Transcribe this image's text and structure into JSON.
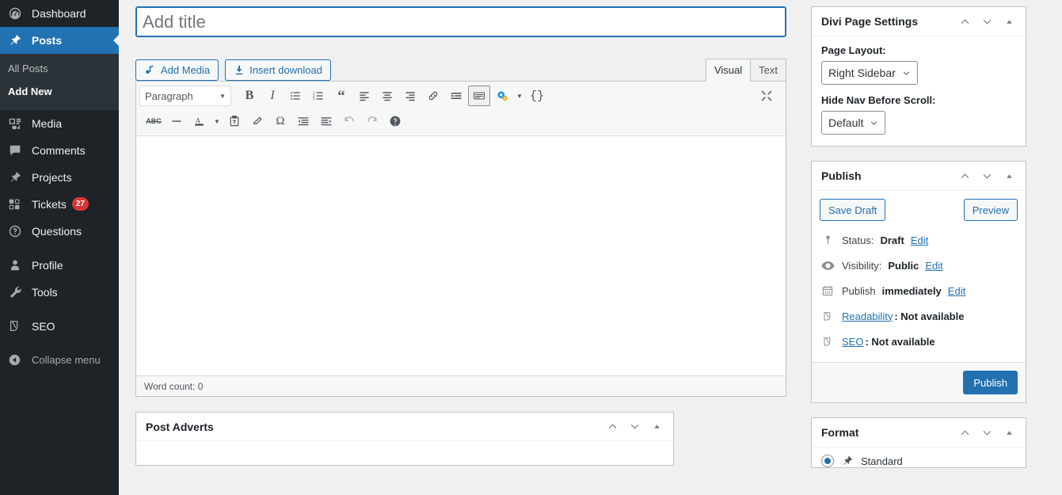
{
  "sidebar": {
    "items": [
      {
        "label": "Dashboard",
        "icon": "dashboard-icon",
        "current": false
      },
      {
        "label": "Posts",
        "icon": "pin-icon",
        "current": true
      },
      {
        "label": "Media",
        "icon": "media-icon",
        "current": false
      },
      {
        "label": "Comments",
        "icon": "comment-icon",
        "current": false
      },
      {
        "label": "Projects",
        "icon": "pin-icon",
        "current": false
      },
      {
        "label": "Tickets",
        "icon": "tickets-icon",
        "current": false,
        "badge": "27"
      },
      {
        "label": "Questions",
        "icon": "question-icon",
        "current": false
      },
      {
        "label": "Profile",
        "icon": "user-icon",
        "current": false
      },
      {
        "label": "Tools",
        "icon": "wrench-icon",
        "current": false
      },
      {
        "label": "SEO",
        "icon": "yoast-icon",
        "current": false
      }
    ],
    "submenu": [
      {
        "label": "All Posts",
        "current": false
      },
      {
        "label": "Add New",
        "current": true
      }
    ],
    "collapse_label": "Collapse menu"
  },
  "editor": {
    "title_placeholder": "Add title",
    "title_value": "",
    "add_media_label": "Add Media",
    "insert_download_label": "Insert download",
    "tabs": [
      {
        "label": "Visual",
        "active": true
      },
      {
        "label": "Text",
        "active": false
      }
    ],
    "format_select": "Paragraph",
    "word_count": "Word count: 0",
    "toolbar_row1": [
      {
        "name": "bold-icon",
        "glyph": "B"
      },
      {
        "name": "italic-icon",
        "glyph": "I"
      },
      {
        "name": "bulleted-list-icon",
        "glyph": ""
      },
      {
        "name": "numbered-list-icon",
        "glyph": ""
      },
      {
        "name": "blockquote-icon",
        "glyph": ""
      },
      {
        "name": "align-left-icon",
        "glyph": ""
      },
      {
        "name": "align-center-icon",
        "glyph": ""
      },
      {
        "name": "align-right-icon",
        "glyph": ""
      },
      {
        "name": "link-icon",
        "glyph": ""
      },
      {
        "name": "read-more-icon",
        "glyph": ""
      },
      {
        "name": "toolbar-toggle-icon",
        "glyph": ""
      },
      {
        "name": "shortcode-gear-icon",
        "glyph": ""
      },
      {
        "name": "code-braces-icon",
        "glyph": "{}"
      }
    ],
    "toolbar_row2": [
      {
        "name": "strikethrough-icon",
        "glyph": "ABC"
      },
      {
        "name": "horizontal-rule-icon",
        "glyph": ""
      },
      {
        "name": "text-color-icon",
        "glyph": "A"
      },
      {
        "name": "paste-as-text-icon",
        "glyph": ""
      },
      {
        "name": "clear-formatting-icon",
        "glyph": ""
      },
      {
        "name": "special-character-icon",
        "glyph": "Ω"
      },
      {
        "name": "outdent-icon",
        "glyph": ""
      },
      {
        "name": "indent-icon",
        "glyph": ""
      },
      {
        "name": "undo-icon",
        "glyph": ""
      },
      {
        "name": "redo-icon",
        "glyph": ""
      },
      {
        "name": "keyboard-shortcuts-icon",
        "glyph": ""
      }
    ],
    "fullscreen_icon": "fullscreen-icon"
  },
  "post_adverts": {
    "title": "Post Adverts"
  },
  "divi_panel": {
    "title": "Divi Page Settings",
    "page_layout_label": "Page Layout:",
    "page_layout_value": "Right Sidebar",
    "hide_nav_label": "Hide Nav Before Scroll:",
    "hide_nav_value": "Default"
  },
  "publish_panel": {
    "title": "Publish",
    "save_draft_label": "Save Draft",
    "preview_label": "Preview",
    "rows": [
      {
        "icon": "pin-status-icon",
        "prefix": "Status: ",
        "value": "Draft",
        "link": "Edit",
        "value_bold": true,
        "link_value": false
      },
      {
        "icon": "eye-icon",
        "prefix": "Visibility: ",
        "value": "Public",
        "link": "Edit",
        "value_bold": true,
        "link_value": false
      },
      {
        "icon": "calendar-icon",
        "prefix": "Publish ",
        "value": "immediately",
        "link": "Edit",
        "value_bold": true,
        "link_value": false
      },
      {
        "icon": "yoast-icon",
        "prefix": "",
        "label_link": "Readability",
        "value": ": Not available",
        "value_bold": true,
        "link_value": true
      },
      {
        "icon": "yoast-icon",
        "prefix": "",
        "label_link": "SEO",
        "value": ": Not available",
        "value_bold": true,
        "link_value": true
      }
    ],
    "publish_label": "Publish"
  },
  "format_panel": {
    "title": "Format",
    "options": [
      {
        "label": "Standard",
        "icon": "pin-icon",
        "selected": true
      }
    ]
  },
  "panel_actions": {
    "up": "move-up-icon",
    "down": "move-down-icon",
    "toggle": "toggle-panel-icon"
  },
  "colors": {
    "accent": "#2271b1",
    "sidebar_bg": "#1d2327",
    "submenu_bg": "#2c3338",
    "badge": "#d63638",
    "page_bg": "#f0f0f1"
  }
}
